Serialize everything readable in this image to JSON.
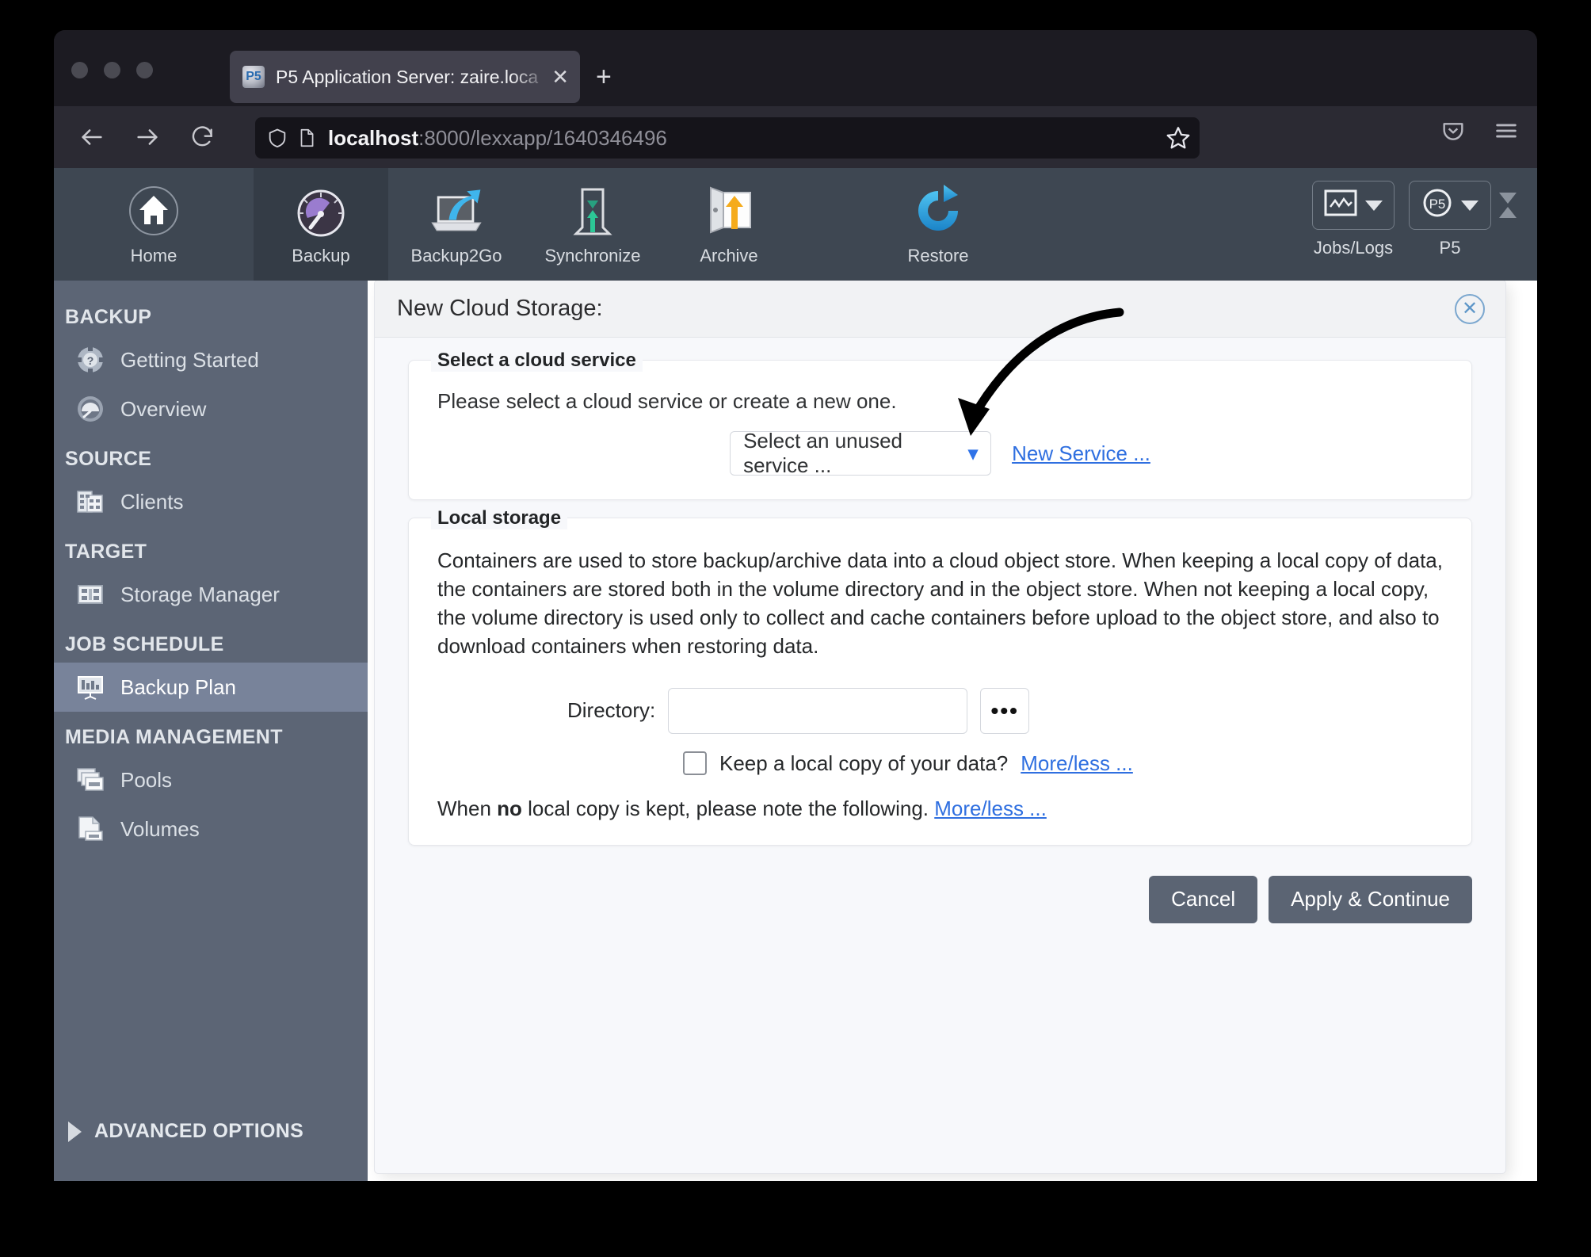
{
  "browser": {
    "tab": {
      "title": "P5 Application Server: zaire.loca",
      "favicon": "p5-favicon-icon",
      "close_label": "✕"
    },
    "new_tab_label": "+",
    "url": {
      "host": "localhost",
      "rest": ":8000/lexxapp/1640346496",
      "full": "localhost:8000/lexxapp/1640346496"
    },
    "nav": {
      "back": "back-arrow-icon",
      "forward": "forward-arrow-icon",
      "reload": "reload-icon",
      "shield": "shield-icon",
      "page": "page-icon",
      "bookmark": "star-icon",
      "pocket": "pocket-icon",
      "menu": "hamburger-menu-icon"
    }
  },
  "toolbar": {
    "items": [
      {
        "label": "Home",
        "icon": "home-icon",
        "active": false
      },
      {
        "label": "Backup",
        "icon": "gauge-icon",
        "active": true
      },
      {
        "label": "Backup2Go",
        "icon": "laptop-arrow-icon",
        "active": false
      },
      {
        "label": "Synchronize",
        "icon": "sync-arrows-icon",
        "active": false
      },
      {
        "label": "Archive",
        "icon": "door-arrow-icon",
        "active": false
      },
      {
        "label": "Restore",
        "icon": "restore-circular-arrow-icon",
        "active": false
      }
    ],
    "buttons": [
      {
        "label": "Jobs/Logs",
        "icon": "chart-window-icon"
      },
      {
        "label": "P5",
        "icon": "p5-circle-icon"
      }
    ],
    "collapse": "collapse-toggle-icon"
  },
  "sidebar": {
    "groups": [
      {
        "title": "BACKUP",
        "items": [
          {
            "label": "Getting Started",
            "icon": "lifebuoy-question-icon",
            "active": false
          },
          {
            "label": "Overview",
            "icon": "overview-gauge-icon",
            "active": false
          }
        ]
      },
      {
        "title": "SOURCE",
        "items": [
          {
            "label": "Clients",
            "icon": "clients-building-icon",
            "active": false
          }
        ]
      },
      {
        "title": "TARGET",
        "items": [
          {
            "label": "Storage Manager",
            "icon": "storage-manager-icon",
            "active": false
          }
        ]
      },
      {
        "title": "JOB SCHEDULE",
        "items": [
          {
            "label": "Backup Plan",
            "icon": "backup-plan-board-icon",
            "active": true
          }
        ]
      },
      {
        "title": "MEDIA MANAGEMENT",
        "items": [
          {
            "label": "Pools",
            "icon": "pools-tapes-icon",
            "active": false
          },
          {
            "label": "Volumes",
            "icon": "volumes-tape-icon",
            "active": false
          }
        ]
      }
    ],
    "advanced_options": "ADVANCED OPTIONS"
  },
  "dialog": {
    "title": "New Cloud Storage:",
    "close_icon": "close-circle-icon",
    "cloud_service": {
      "legend": "Select a cloud service",
      "hint": "Please select a cloud service or create a new one.",
      "select_value": "Select an unused service ...",
      "select_chevron": "chevron-down-icon",
      "new_service_link": "New Service ..."
    },
    "local_storage": {
      "legend": "Local storage",
      "paragraph": "Containers are used to store backup/archive data into a cloud object store. When keeping a local copy of data, the containers are stored both in the volume directory and in the object store. When not keeping a local copy, the volume directory is used only to collect and cache containers before upload to the object store, and also to download containers when restoring data.",
      "directory_label": "Directory:",
      "directory_value": "",
      "browse_button": "•••",
      "checkbox_checked": false,
      "checkbox_label": "Keep a local copy of your data?",
      "checkbox_more_link": "More/less ...",
      "note_prefix": "When ",
      "note_bold": "no",
      "note_suffix": " local copy is kept, please note the following.",
      "note_more_link": "More/less ..."
    },
    "buttons": {
      "cancel": "Cancel",
      "apply": "Apply & Continue"
    }
  },
  "annotation": {
    "arrow": "curved-pointer-arrow",
    "color": "#000000"
  },
  "colors": {
    "accent_link": "#2f6fe0",
    "toolbar_bg": "#3e4752",
    "sidebar_bg": "#5c6575",
    "sidebar_active": "#78839a",
    "button_bg": "#5b6473"
  }
}
